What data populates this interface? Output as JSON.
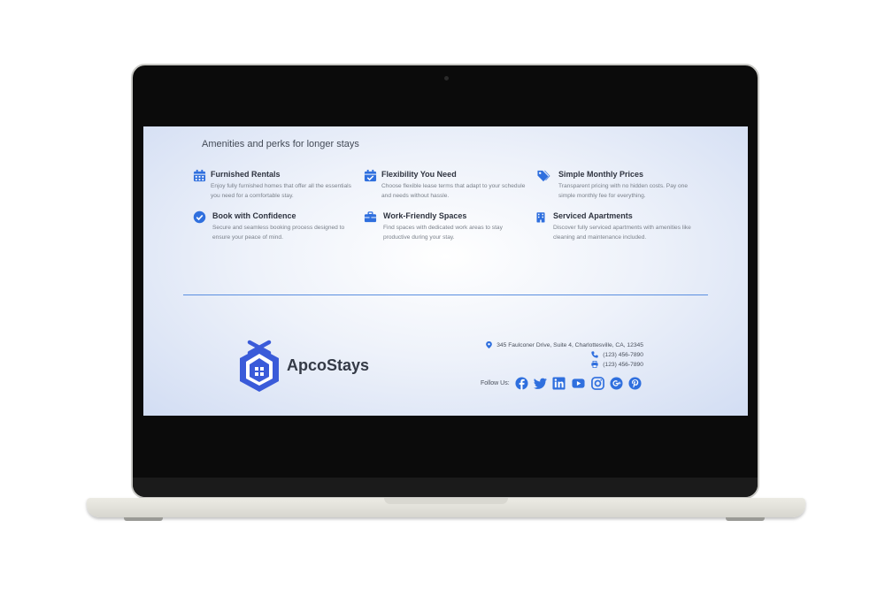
{
  "section": {
    "title": "Amenities and perks for longer stays"
  },
  "features": [
    {
      "title": "Furnished Rentals",
      "description": "Enjoy fully furnished homes that offer all the essentials you need for a comfortable stay.",
      "icon": "calendar-icon"
    },
    {
      "title": "Flexibility You Need",
      "description": "Choose flexible lease terms that adapt to your schedule and needs without hassle.",
      "icon": "calendar-check-icon"
    },
    {
      "title": "Simple Monthly Prices",
      "description": "Transparent pricing with no hidden costs. Pay one simple monthly fee for everything.",
      "icon": "tags-icon"
    },
    {
      "title": "Book with Confidence",
      "description": "Secure and seamless booking process designed to ensure your peace of mind.",
      "icon": "check-circle-icon"
    },
    {
      "title": "Work-Friendly Spaces",
      "description": "Find spaces with dedicated work areas to stay productive during your stay.",
      "icon": "briefcase-icon"
    },
    {
      "title": "Serviced Apartments",
      "description": "Discover fully serviced apartments with amenities like cleaning and maintenance included.",
      "icon": "building-icon"
    }
  ],
  "footer": {
    "brand": "ApcoStays",
    "address": "345 Faulconer Drive, Suite 4, Charlottesville, CA, 12345",
    "phone": "(123) 456-7890",
    "fax": "(123) 456-7890",
    "follow_label": "Follow Us:",
    "social": [
      "facebook-icon",
      "twitter-icon",
      "linkedin-icon",
      "youtube-icon",
      "instagram-icon",
      "google-plus-icon",
      "pinterest-icon"
    ]
  },
  "colors": {
    "accent": "#2f6fde",
    "logo": "#3a5bd9",
    "text": "#2f3440",
    "muted": "#7a808a"
  }
}
